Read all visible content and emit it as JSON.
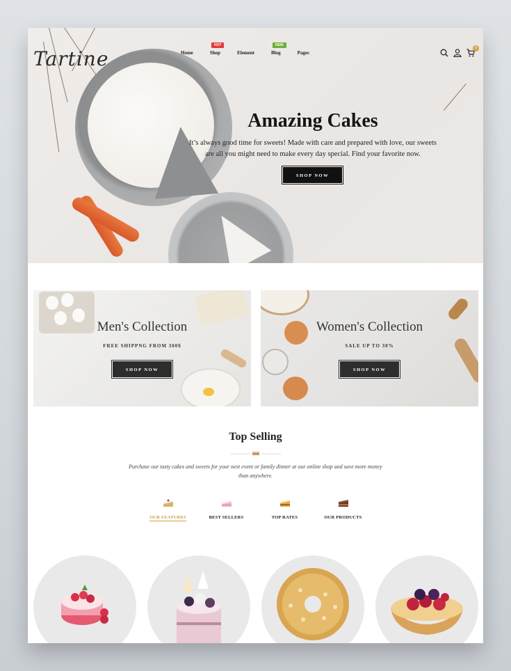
{
  "header": {
    "logo": "Tartine",
    "nav": [
      {
        "label": "Home",
        "badge": ""
      },
      {
        "label": "Shop",
        "badge": "HOT"
      },
      {
        "label": "Element",
        "badge": ""
      },
      {
        "label": "Blog",
        "badge": "NEW"
      },
      {
        "label": "Pages",
        "badge": ""
      }
    ],
    "icons": [
      "search-icon",
      "user-icon",
      "cart-icon"
    ],
    "cart_count": "0"
  },
  "hero": {
    "title": "Amazing Cakes",
    "subtitle": "It’s always good time for sweets! Made with care and prepared with love, our sweets are all you might need to make every day special. Find your favorite now.",
    "button": "SHOP NOW"
  },
  "banners": [
    {
      "title": "Men's Collection",
      "subtitle": "FREE SHIPPNG FROM 300$",
      "button": "SHOP NOW"
    },
    {
      "title": "Women's Collection",
      "subtitle": "SALE UP TO 30%",
      "button": "SHOP NOW"
    }
  ],
  "top_selling": {
    "title": "Top Selling",
    "description": "Purchase our tasty cakes and sweets for your next event or family dinner at our online shop and save more money than anywhere.",
    "tabs": [
      {
        "label": "OUR FEATURES",
        "icon": "cake-slice-icon",
        "active": true
      },
      {
        "label": "BEST SELLERS",
        "icon": "pink-cake-icon",
        "active": false
      },
      {
        "label": "TOP RATES",
        "icon": "layer-cake-icon",
        "active": false
      },
      {
        "label": "OUR PRODUCTS",
        "icon": "chocolate-cake-icon",
        "active": false
      }
    ]
  },
  "products": [
    {
      "name": "raspberry-mousse-cake"
    },
    {
      "name": "layered-berry-cake"
    },
    {
      "name": "nut-donut"
    },
    {
      "name": "berry-tart"
    }
  ],
  "colors": {
    "accent": "#c9a04a",
    "hot": "#e03a3a",
    "new": "#6fae3b",
    "dark": "#111111"
  }
}
